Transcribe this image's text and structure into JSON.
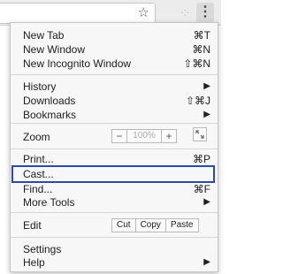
{
  "toolbar": {
    "star_icon": "star-icon",
    "menu_icon": "vertical-dots-icon"
  },
  "menu": {
    "new_tab": {
      "label": "New Tab",
      "shortcut": "⌘T"
    },
    "new_window": {
      "label": "New Window",
      "shortcut": "⌘N"
    },
    "new_incognito": {
      "label": "New Incognito Window",
      "shortcut": "⇧⌘N"
    },
    "history": {
      "label": "History",
      "arrow": "▶"
    },
    "downloads": {
      "label": "Downloads",
      "shortcut": "⇧⌘J"
    },
    "bookmarks": {
      "label": "Bookmarks",
      "arrow": "▶"
    },
    "zoom": {
      "label": "Zoom",
      "minus": "−",
      "value": "100%",
      "plus": "+"
    },
    "print": {
      "label": "Print...",
      "shortcut": "⌘P"
    },
    "cast": {
      "label": "Cast..."
    },
    "find": {
      "label": "Find...",
      "shortcut": "⌘F"
    },
    "more_tools": {
      "label": "More Tools",
      "arrow": "▶"
    },
    "edit": {
      "label": "Edit",
      "cut": "Cut",
      "copy": "Copy",
      "paste": "Paste"
    },
    "settings": {
      "label": "Settings"
    },
    "help": {
      "label": "Help",
      "arrow": "▶"
    }
  }
}
